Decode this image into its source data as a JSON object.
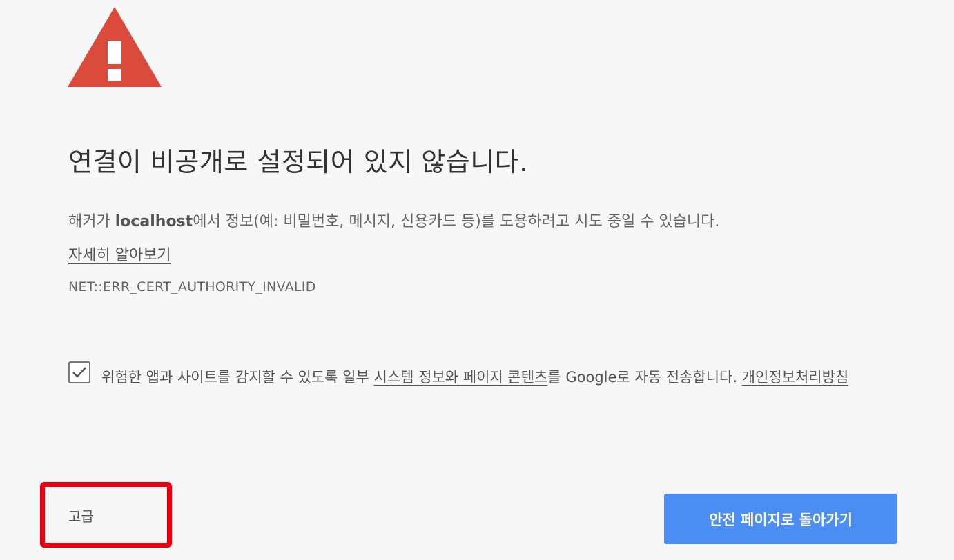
{
  "colors": {
    "warning_red": "#db4b3b",
    "primary_blue": "#4a8df3",
    "highlight_red": "#e60012",
    "background": "#f7f7f7"
  },
  "header": {
    "icon": "warning-triangle-icon",
    "title": "연결이 비공개로 설정되어 있지 않습니다."
  },
  "main": {
    "explanation_prefix": "해커가 ",
    "host": "localhost",
    "explanation_suffix": "에서 정보(예: 비밀번호, 메시지, 신용카드 등)를 도용하려고 시도 중일 수 있습니다.",
    "learn_more": "자세히 알아보기",
    "error_code": "NET::ERR_CERT_AUTHORITY_INVALID"
  },
  "report": {
    "checked": true,
    "text_1": "위험한 앱과 사이트를 감지할 수 있도록 일부 ",
    "link_1": "시스템 정보와 페이지 콘텐츠",
    "text_2": "를 Google로 자동 전송합니다. ",
    "link_2": "개인정보처리방침"
  },
  "buttons": {
    "advanced": "고급",
    "back_to_safety": "안전 페이지로 돌아가기"
  }
}
